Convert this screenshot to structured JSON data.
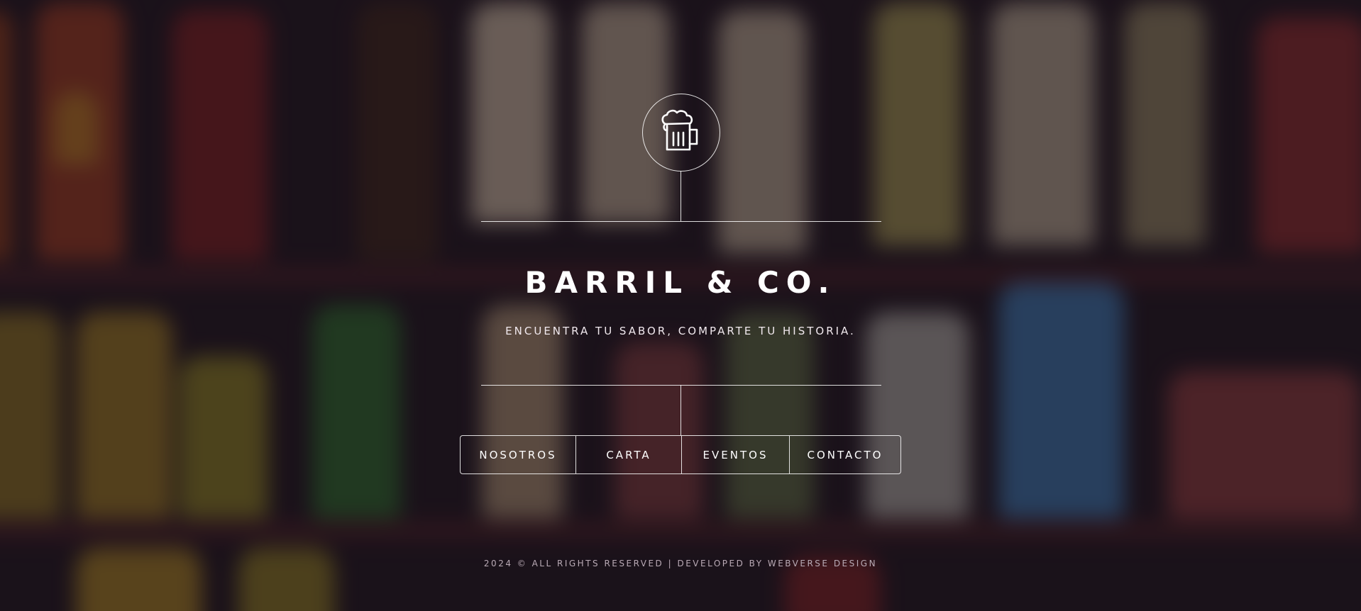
{
  "brand": {
    "logo_icon": "beer-mug-icon",
    "title": "BARRIL & CO.",
    "tagline": "ENCUENTRA TU SABOR, COMPARTE TU HISTORIA."
  },
  "nav": {
    "items": [
      {
        "label": "NOSOTROS"
      },
      {
        "label": "CARTA"
      },
      {
        "label": "EVENTOS"
      },
      {
        "label": "CONTACTO"
      }
    ]
  },
  "footer": {
    "text": "2024 © ALL RIGHTS RESERVED | DEVELOPED BY WEBVERSE DESIGN"
  },
  "colors": {
    "text": "#ffffff",
    "lines": "#ffffff",
    "background": "#1c141c"
  }
}
